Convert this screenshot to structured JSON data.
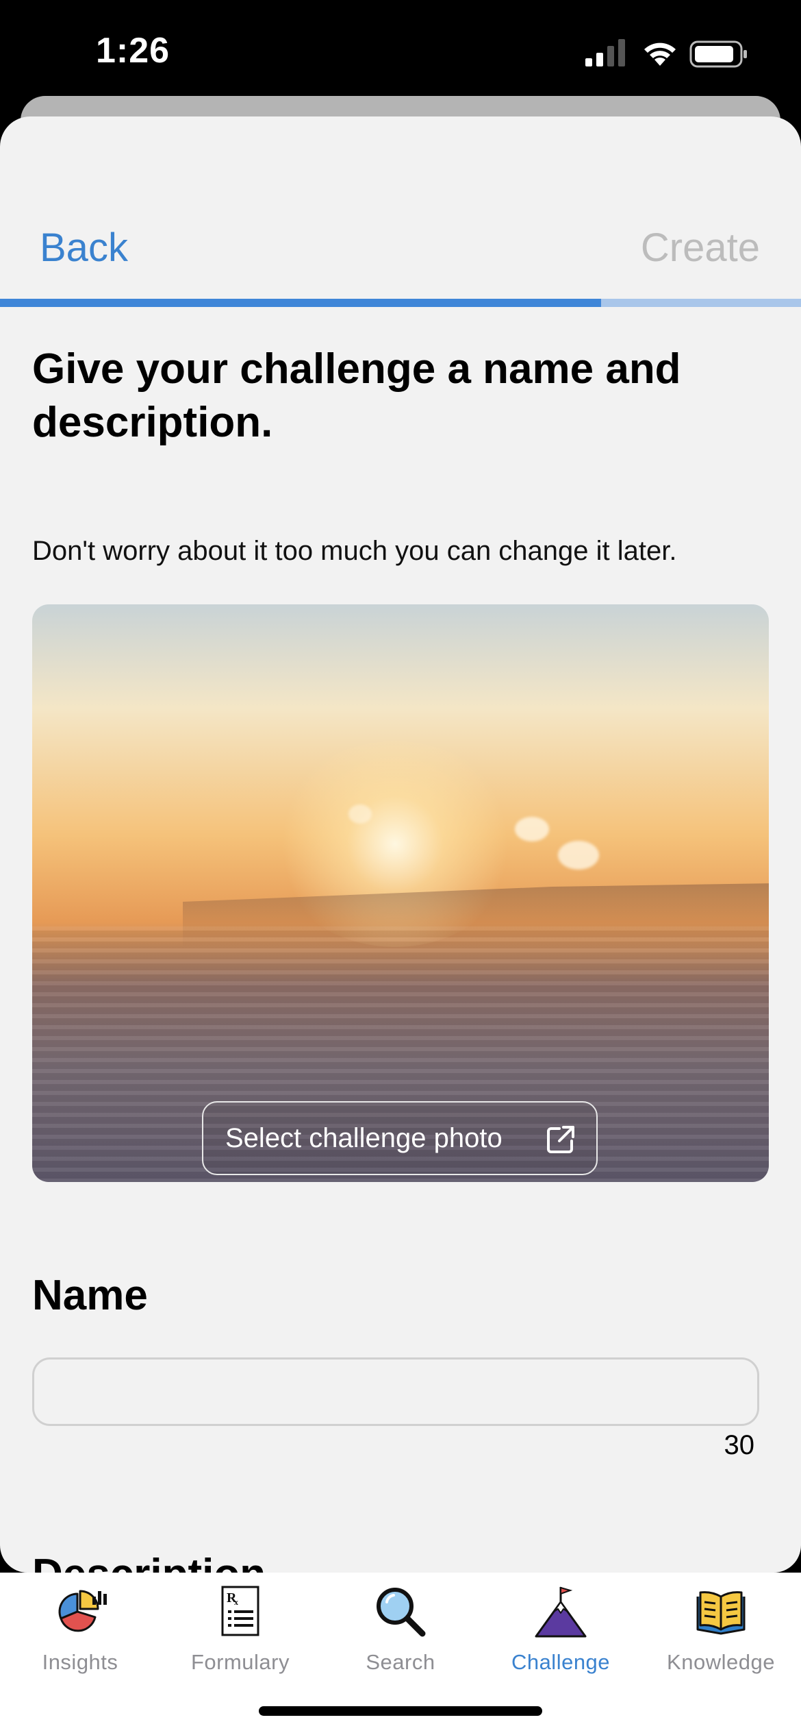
{
  "status": {
    "time": "1:26"
  },
  "nav": {
    "back_label": "Back",
    "create_label": "Create"
  },
  "progress": {
    "fraction": 0.75
  },
  "content": {
    "heading": "Give your challenge a name and description.",
    "subtext": "Don't worry about it too much you can change it later.",
    "photo_button_label": "Select challenge photo",
    "name_label": "Name",
    "name_value": "",
    "name_counter": "30",
    "description_label": "Description"
  },
  "tabs": [
    {
      "label": "Insights",
      "icon": "pie-chart-icon",
      "active": false
    },
    {
      "label": "Formulary",
      "icon": "prescription-icon",
      "active": false
    },
    {
      "label": "Search",
      "icon": "magnifier-icon",
      "active": false
    },
    {
      "label": "Challenge",
      "icon": "mountain-flag-icon",
      "active": true
    },
    {
      "label": "Knowledge",
      "icon": "book-icon",
      "active": false
    }
  ],
  "colors": {
    "accent": "#3a82cf",
    "inactive": "#8e8e93",
    "background": "#f2f2f2"
  }
}
